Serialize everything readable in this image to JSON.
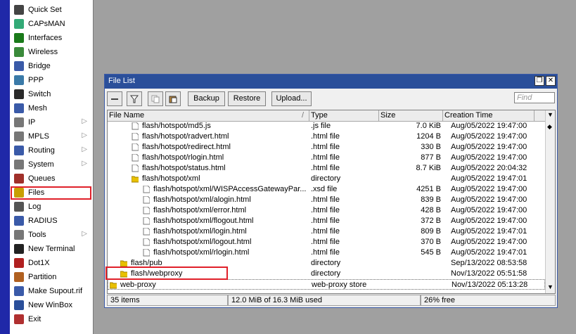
{
  "sidebar": {
    "items": [
      {
        "label": "Quick Set",
        "icon": "wand-icon",
        "submenu": false
      },
      {
        "label": "CAPsMAN",
        "icon": "capsman-icon",
        "submenu": false
      },
      {
        "label": "Interfaces",
        "icon": "interfaces-icon",
        "submenu": false
      },
      {
        "label": "Wireless",
        "icon": "wireless-icon",
        "submenu": false
      },
      {
        "label": "Bridge",
        "icon": "bridge-icon",
        "submenu": false
      },
      {
        "label": "PPP",
        "icon": "ppp-icon",
        "submenu": false
      },
      {
        "label": "Switch",
        "icon": "switch-icon",
        "submenu": false
      },
      {
        "label": "Mesh",
        "icon": "mesh-icon",
        "submenu": false
      },
      {
        "label": "IP",
        "icon": "ip-icon",
        "submenu": true
      },
      {
        "label": "MPLS",
        "icon": "mpls-icon",
        "submenu": true
      },
      {
        "label": "Routing",
        "icon": "routing-icon",
        "submenu": true
      },
      {
        "label": "System",
        "icon": "gear-icon",
        "submenu": true
      },
      {
        "label": "Queues",
        "icon": "queues-icon",
        "submenu": false
      },
      {
        "label": "Files",
        "icon": "folder-icon",
        "submenu": false
      },
      {
        "label": "Log",
        "icon": "log-icon",
        "submenu": false
      },
      {
        "label": "RADIUS",
        "icon": "radius-icon",
        "submenu": false
      },
      {
        "label": "Tools",
        "icon": "tools-icon",
        "submenu": true
      },
      {
        "label": "New Terminal",
        "icon": "terminal-icon",
        "submenu": false
      },
      {
        "label": "Dot1X",
        "icon": "dot1x-icon",
        "submenu": false
      },
      {
        "label": "Partition",
        "icon": "partition-icon",
        "submenu": false
      },
      {
        "label": "Make Supout.rif",
        "icon": "supout-icon",
        "submenu": false
      },
      {
        "label": "New WinBox",
        "icon": "winbox-icon",
        "submenu": false
      },
      {
        "label": "Exit",
        "icon": "exit-icon",
        "submenu": false
      }
    ],
    "submenu_arrow": "▷"
  },
  "window": {
    "title": "File List",
    "restore_glyph": "❐",
    "close_glyph": "✕",
    "toolbar": {
      "backup": "Backup",
      "restore": "Restore",
      "upload": "Upload...",
      "find_placeholder": "Find"
    },
    "columns": {
      "name": "File Name",
      "sort_glyph": "/",
      "type": "Type",
      "size": "Size",
      "created": "Creation Time"
    },
    "rows": [
      {
        "name": "flash/hotspot/md5.js",
        "type": ".js file",
        "size": "7.0 KiB",
        "created": "Aug/05/2022 19:47:00",
        "kind": "file",
        "indent": 2
      },
      {
        "name": "flash/hotspot/radvert.html",
        "type": ".html file",
        "size": "1204 B",
        "created": "Aug/05/2022 19:47:00",
        "kind": "file",
        "indent": 2
      },
      {
        "name": "flash/hotspot/redirect.html",
        "type": ".html file",
        "size": "330 B",
        "created": "Aug/05/2022 19:47:00",
        "kind": "file",
        "indent": 2
      },
      {
        "name": "flash/hotspot/rlogin.html",
        "type": ".html file",
        "size": "877 B",
        "created": "Aug/05/2022 19:47:00",
        "kind": "file",
        "indent": 2
      },
      {
        "name": "flash/hotspot/status.html",
        "type": ".html file",
        "size": "8.7 KiB",
        "created": "Aug/05/2022 20:04:32",
        "kind": "file",
        "indent": 2
      },
      {
        "name": "flash/hotspot/xml",
        "type": "directory",
        "size": "",
        "created": "Aug/05/2022 19:47:01",
        "kind": "folder",
        "indent": 2
      },
      {
        "name": "flash/hotspot/xml/WISPAccessGatewayPar...",
        "type": ".xsd file",
        "size": "4251 B",
        "created": "Aug/05/2022 19:47:00",
        "kind": "file",
        "indent": 3
      },
      {
        "name": "flash/hotspot/xml/alogin.html",
        "type": ".html file",
        "size": "839 B",
        "created": "Aug/05/2022 19:47:00",
        "kind": "file",
        "indent": 3
      },
      {
        "name": "flash/hotspot/xml/error.html",
        "type": ".html file",
        "size": "428 B",
        "created": "Aug/05/2022 19:47:00",
        "kind": "file",
        "indent": 3
      },
      {
        "name": "flash/hotspot/xml/flogout.html",
        "type": ".html file",
        "size": "372 B",
        "created": "Aug/05/2022 19:47:00",
        "kind": "file",
        "indent": 3
      },
      {
        "name": "flash/hotspot/xml/login.html",
        "type": ".html file",
        "size": "809 B",
        "created": "Aug/05/2022 19:47:01",
        "kind": "file",
        "indent": 3
      },
      {
        "name": "flash/hotspot/xml/logout.html",
        "type": ".html file",
        "size": "370 B",
        "created": "Aug/05/2022 19:47:00",
        "kind": "file",
        "indent": 3
      },
      {
        "name": "flash/hotspot/xml/rlogin.html",
        "type": ".html file",
        "size": "545 B",
        "created": "Aug/05/2022 19:47:01",
        "kind": "file",
        "indent": 3
      },
      {
        "name": "flash/pub",
        "type": "directory",
        "size": "",
        "created": "Sep/13/2022 08:53:58",
        "kind": "folder",
        "indent": 1
      },
      {
        "name": "flash/webproxy",
        "type": "directory",
        "size": "",
        "created": "Nov/13/2022 05:51:58",
        "kind": "folder",
        "indent": 1
      },
      {
        "name": "web-proxy",
        "type": "web-proxy store",
        "size": "",
        "created": "Nov/13/2022 05:13:28",
        "kind": "folder",
        "indent": 0,
        "selected": true
      }
    ],
    "status": {
      "items": "35 items",
      "usage": "12.0 MiB of 16.3 MiB used",
      "free": "26% free"
    },
    "scroll": {
      "menu_glyph": "▼",
      "up_glyph": "◆",
      "down_glyph": "▼"
    }
  },
  "colors": {
    "accent_blue": "#2a4f9a",
    "sidebar_strip": "#1f28a8",
    "highlight_red": "#e0202a",
    "folder_yellow": "#e8c000"
  }
}
